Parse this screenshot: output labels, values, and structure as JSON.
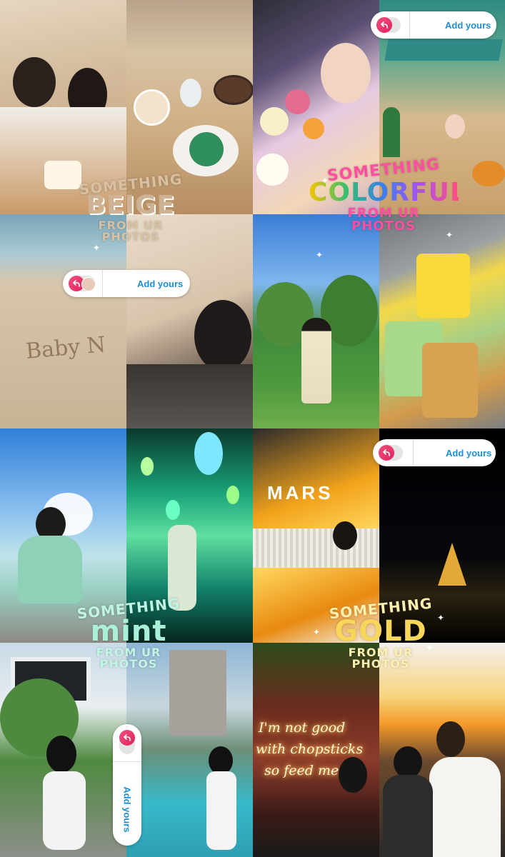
{
  "add_yours_label": "Add yours",
  "stickers": {
    "beige": {
      "line1": "SOMETHING",
      "word": "BEIGE",
      "line3": "FROM UR",
      "line4": "PHOTOS"
    },
    "colorful": {
      "line1": "SOMETHING",
      "word": "COLORFUL",
      "line3": "FROM UR",
      "line4": "PHOTOS"
    },
    "mint": {
      "line1": "SOMETHING",
      "word": "mint",
      "line3": "FROM UR",
      "line4": "PHOTOS"
    },
    "gold": {
      "line1": "SOMETHING",
      "word": "GOLD",
      "line3": "FROM UR",
      "line4": "PHOTOS"
    }
  },
  "sand_writing": "Baby N",
  "sign_mars": "MARS",
  "neon_sign": [
    "I'm not good",
    "with chopsticks",
    "so feed me"
  ],
  "colors": {
    "sticker_beige": "#cdb294",
    "sticker_mint": "#a8f0d8",
    "sticker_gold": "#fff0b0",
    "pill_text": "#1e8fd6",
    "pill_accent": "#e0245e"
  },
  "icons": [
    "add-yours-reply-icon",
    "sparkle-icon"
  ]
}
